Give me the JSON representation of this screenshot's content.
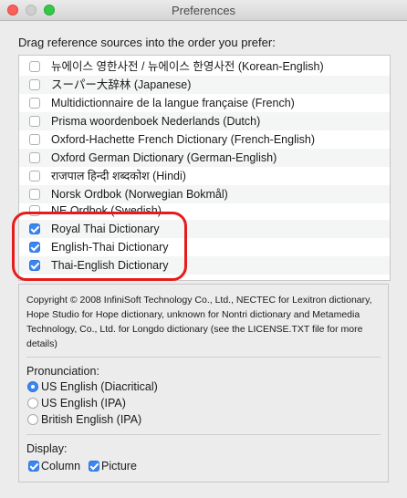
{
  "window": {
    "title": "Preferences"
  },
  "instruction": "Drag reference sources into the order you prefer:",
  "sources": [
    {
      "label": "뉴에이스 영한사전 / 뉴에이스 한영사전 (Korean-English)",
      "checked": false
    },
    {
      "label": "スーパー大辞林 (Japanese)",
      "checked": false
    },
    {
      "label": "Multidictionnaire de la langue française (French)",
      "checked": false
    },
    {
      "label": "Prisma woordenboek Nederlands (Dutch)",
      "checked": false
    },
    {
      "label": "Oxford-Hachette French Dictionary (French-English)",
      "checked": false
    },
    {
      "label": "Oxford German Dictionary (German-English)",
      "checked": false
    },
    {
      "label": "राजपाल हिन्दी शब्दकोश (Hindi)",
      "checked": false
    },
    {
      "label": "Norsk Ordbok (Norwegian Bokmål)",
      "checked": false
    },
    {
      "label": "NE Ordbok (Swedish)",
      "checked": false
    },
    {
      "label": "Royal Thai Dictionary",
      "checked": true
    },
    {
      "label": "English-Thai Dictionary",
      "checked": true
    },
    {
      "label": "Thai-English Dictionary",
      "checked": true
    }
  ],
  "copyright": "Copyright © 2008 InfiniSoft Technology Co., Ltd., NECTEC for Lexitron dictionary, Hope Studio for Hope dictionary, unknown for Nontri dictionary and Metamedia Technology, Co., Ltd. for Longdo dictionary (see the LICENSE.TXT file for more details)",
  "pronunciation": {
    "label": "Pronunciation:",
    "options": [
      {
        "label": "US English (Diacritical)",
        "selected": true
      },
      {
        "label": "US English (IPA)",
        "selected": false
      },
      {
        "label": "British English (IPA)",
        "selected": false
      }
    ]
  },
  "display": {
    "label": "Display:",
    "column": {
      "label": "Column",
      "checked": true
    },
    "picture": {
      "label": "Picture",
      "checked": true
    }
  },
  "colors": {
    "accent": "#3b86ef",
    "highlight": "#e61c1c"
  }
}
